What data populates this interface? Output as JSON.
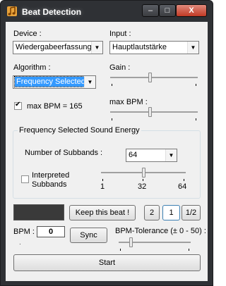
{
  "window": {
    "title": "Beat Detection",
    "minimize_glyph": "–",
    "maximize_glyph": "□",
    "close_glyph": "X"
  },
  "device": {
    "label": "Device :",
    "value": "Wiedergabeerfassung"
  },
  "input": {
    "label": "Input :",
    "value": "Hauptlautstärke"
  },
  "algorithm": {
    "label": "Algorithm :",
    "value": "Frequency Selected"
  },
  "gain": {
    "label": "Gain :",
    "level": 0.45
  },
  "max_bpm_toggle": {
    "label": "max BPM = 165",
    "checked": true
  },
  "max_bpm": {
    "label": "max BPM :",
    "level": 0.45
  },
  "group": {
    "title": "Frequency Selected Sound Energy",
    "subbands_label": "Number of Subbands :",
    "subbands_value": "64",
    "interpreted_label_1": "Interpreted",
    "interpreted_label_2": "Subbands",
    "interpreted_checked": false,
    "slider_level": 0.5,
    "tick_min": "1",
    "tick_mid": "32",
    "tick_max": "64"
  },
  "beat_button": "Keep this beat !",
  "multiplier_buttons": [
    "2",
    "1",
    "1/2"
  ],
  "bpm": {
    "label": "BPM :",
    "value": "0"
  },
  "sync_button": "Sync",
  "tolerance": {
    "label": "BPM-Tolerance (± 0 - 50) :",
    "level": 0.15
  },
  "start_button": "Start",
  "colors": {
    "indicator": "#3a3a3a",
    "selection": "#3399ff",
    "titlebar": "#2f3135"
  }
}
